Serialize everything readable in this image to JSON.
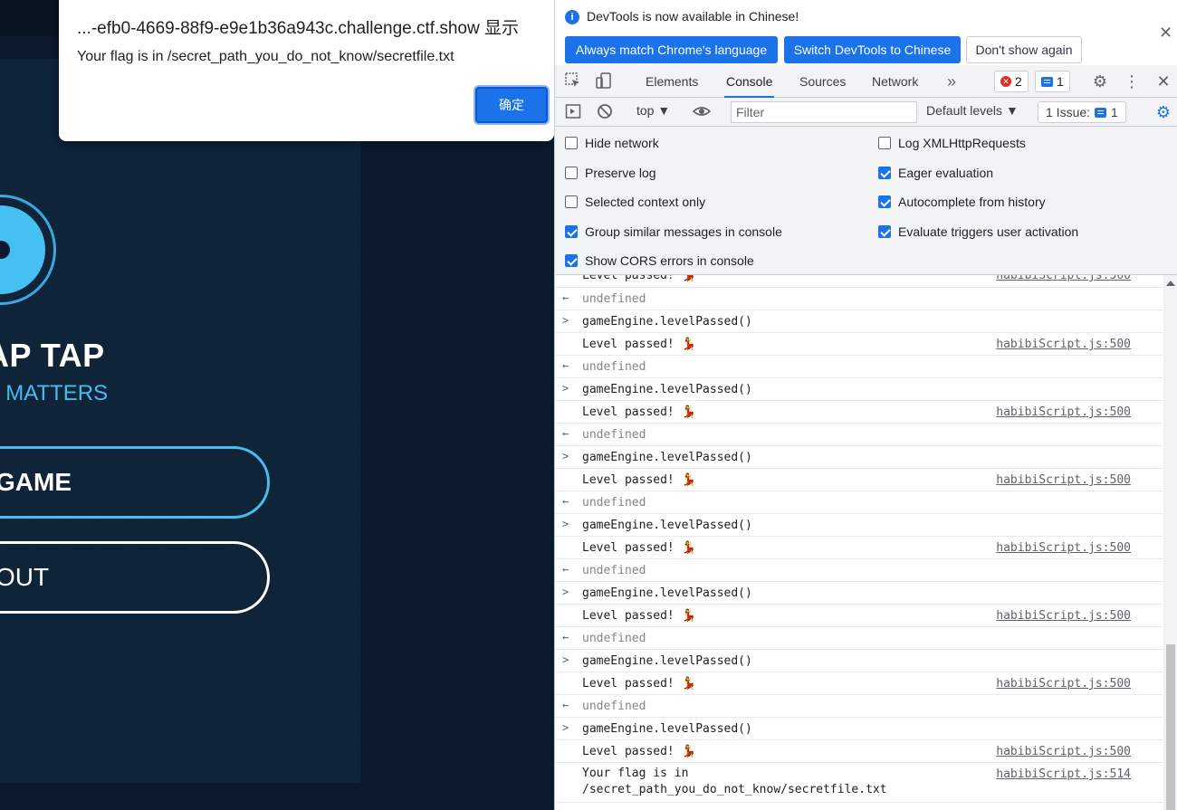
{
  "game": {
    "title": "AP TAP",
    "subtitle": "P MATTERS",
    "start_label": "GAME",
    "about_label": "OUT"
  },
  "alert": {
    "title": "...-efb0-4669-88f9-e9e1b36a943c.challenge.ctf.show 显示",
    "message": "Your flag is in /secret_path_you_do_not_know/secretfile.txt",
    "ok_label": "确定"
  },
  "devtools": {
    "infobar": {
      "message": "DevTools is now available in Chinese!",
      "btn_match": "Always match Chrome's language",
      "btn_switch": "Switch DevTools to Chinese",
      "btn_dismiss": "Don't show again"
    },
    "tabs": [
      "Elements",
      "Console",
      "Sources",
      "Network"
    ],
    "error_count": "2",
    "message_count": "1",
    "toolbar": {
      "context": "top",
      "filter_placeholder": "Filter",
      "levels": "Default levels",
      "issues": "1 Issue:",
      "issues_count": "1"
    },
    "settings": {
      "left": [
        {
          "label": "Hide network",
          "checked": false
        },
        {
          "label": "Preserve log",
          "checked": false
        },
        {
          "label": "Selected context only",
          "checked": false
        },
        {
          "label": "Group similar messages in console",
          "checked": true
        },
        {
          "label": "Show CORS errors in console",
          "checked": true
        }
      ],
      "right": [
        {
          "label": "Log XMLHttpRequests",
          "checked": false
        },
        {
          "label": "Eager evaluation",
          "checked": true
        },
        {
          "label": "Autocomplete from history",
          "checked": true
        },
        {
          "label": "Evaluate triggers user activation",
          "checked": true
        }
      ]
    },
    "console": {
      "partial_log": "Level passed! ",
      "partial_src": "habibiScript.js:500",
      "undefined_text": "undefined",
      "command": "gameEngine.levelPassed()",
      "log_text": "Level passed! ",
      "log_emoji": "💃",
      "log_src": "habibiScript.js:500",
      "flag_line1": "Your flag is in",
      "flag_line2": "/secret_path_you_do_not_know/secretfile.txt",
      "flag_src": "habibiScript.js:514"
    }
  }
}
